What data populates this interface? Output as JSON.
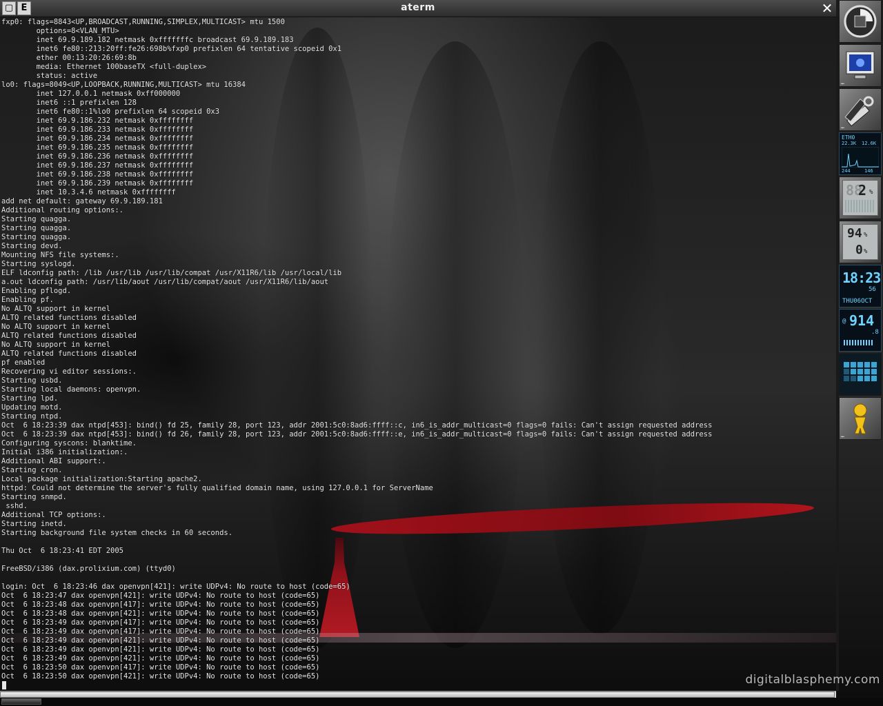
{
  "window": {
    "title": "aterm",
    "menu_button": "E",
    "close_glyph": "✕",
    "iconify_glyph": "▢"
  },
  "terminal": {
    "lines": [
      "fxp0: flags=8843<UP,BROADCAST,RUNNING,SIMPLEX,MULTICAST> mtu 1500",
      "        options=8<VLAN_MTU>",
      "        inet 69.9.189.182 netmask 0xfffffffc broadcast 69.9.189.183",
      "        inet6 fe80::213:20ff:fe26:698b%fxp0 prefixlen 64 tentative scopeid 0x1",
      "        ether 00:13:20:26:69:8b",
      "        media: Ethernet 100baseTX <full-duplex>",
      "        status: active",
      "lo0: flags=8049<UP,LOOPBACK,RUNNING,MULTICAST> mtu 16384",
      "        inet 127.0.0.1 netmask 0xff000000",
      "        inet6 ::1 prefixlen 128",
      "        inet6 fe80::1%lo0 prefixlen 64 scopeid 0x3",
      "        inet 69.9.186.232 netmask 0xffffffff",
      "        inet 69.9.186.233 netmask 0xffffffff",
      "        inet 69.9.186.234 netmask 0xffffffff",
      "        inet 69.9.186.235 netmask 0xffffffff",
      "        inet 69.9.186.236 netmask 0xffffffff",
      "        inet 69.9.186.237 netmask 0xffffffff",
      "        inet 69.9.186.238 netmask 0xffffffff",
      "        inet 69.9.186.239 netmask 0xffffffff",
      "        inet 10.3.4.6 netmask 0xffffffff",
      "add net default: gateway 69.9.189.181",
      "Additional routing options:.",
      "Starting quagga.",
      "Starting quagga.",
      "Starting quagga.",
      "Starting devd.",
      "Mounting NFS file systems:.",
      "Starting syslogd.",
      "ELF ldconfig path: /lib /usr/lib /usr/lib/compat /usr/X11R6/lib /usr/local/lib",
      "a.out ldconfig path: /usr/lib/aout /usr/lib/compat/aout /usr/X11R6/lib/aout",
      "Enabling pflogd.",
      "Enabling pf.",
      "No ALTQ support in kernel",
      "ALTQ related functions disabled",
      "No ALTQ support in kernel",
      "ALTQ related functions disabled",
      "No ALTQ support in kernel",
      "ALTQ related functions disabled",
      "pf enabled",
      "Recovering vi editor sessions:.",
      "Starting usbd.",
      "Starting local daemons: openvpn.",
      "Starting lpd.",
      "Updating motd.",
      "Starting ntpd.",
      "Oct  6 18:23:39 dax ntpd[453]: bind() fd 25, family 28, port 123, addr 2001:5c0:8ad6:ffff::c, in6_is_addr_multicast=0 flags=0 fails: Can't assign requested address",
      "Oct  6 18:23:39 dax ntpd[453]: bind() fd 26, family 28, port 123, addr 2001:5c0:8ad6:ffff::e, in6_is_addr_multicast=0 flags=0 fails: Can't assign requested address",
      "Configuring syscons: blanktime.",
      "Initial i386 initialization:.",
      "Additional ABI support:.",
      "Starting cron.",
      "Local package initialization:Starting apache2.",
      "httpd: Could not determine the server's fully qualified domain name, using 127.0.0.1 for ServerName",
      "Starting snmpd.",
      " sshd.",
      "Additional TCP options:.",
      "Starting inetd.",
      "Starting background file system checks in 60 seconds.",
      "",
      "Thu Oct  6 18:23:41 EDT 2005",
      "",
      "FreeBSD/i386 (dax.prolixium.com) (ttyd0)",
      "",
      "login: Oct  6 18:23:46 dax openvpn[421]: write UDPv4: No route to host (code=65)",
      "Oct  6 18:23:47 dax openvpn[421]: write UDPv4: No route to host (code=65)",
      "Oct  6 18:23:48 dax openvpn[417]: write UDPv4: No route to host (code=65)",
      "Oct  6 18:23:48 dax openvpn[421]: write UDPv4: No route to host (code=65)",
      "Oct  6 18:23:49 dax openvpn[417]: write UDPv4: No route to host (code=65)",
      "Oct  6 18:23:49 dax openvpn[417]: write UDPv4: No route to host (code=65)",
      "Oct  6 18:23:49 dax openvpn[421]: write UDPv4: No route to host (code=65)",
      "Oct  6 18:23:49 dax openvpn[421]: write UDPv4: No route to host (code=65)",
      "Oct  6 18:23:49 dax openvpn[421]: write UDPv4: No route to host (code=65)",
      "Oct  6 18:23:50 dax openvpn[417]: write UDPv4: No route to host (code=65)",
      "Oct  6 18:23:50 dax openvpn[421]: write UDPv4: No route to host (code=65)"
    ]
  },
  "watermark": "digitalblasphemy.com",
  "dock": {
    "net_monitor": {
      "label": "ETH0",
      "rx": "22.3K",
      "tx": "12.6K",
      "foot_left": "244",
      "foot_right": "146"
    },
    "cpu_monitor": {
      "value": "2",
      "unit": "%"
    },
    "mem_monitor": {
      "mem": "94",
      "swap": "0",
      "unit": "%"
    },
    "clock": {
      "time": "18:23",
      "seconds": "56",
      "date": "THU06OCT"
    },
    "volume": {
      "value": "914",
      "sub": ".8"
    }
  },
  "colors": {
    "terminal_text": "#e6e6e6",
    "lcd_blue": "#6fd3ff",
    "ribbon_red": "#b0101a"
  }
}
